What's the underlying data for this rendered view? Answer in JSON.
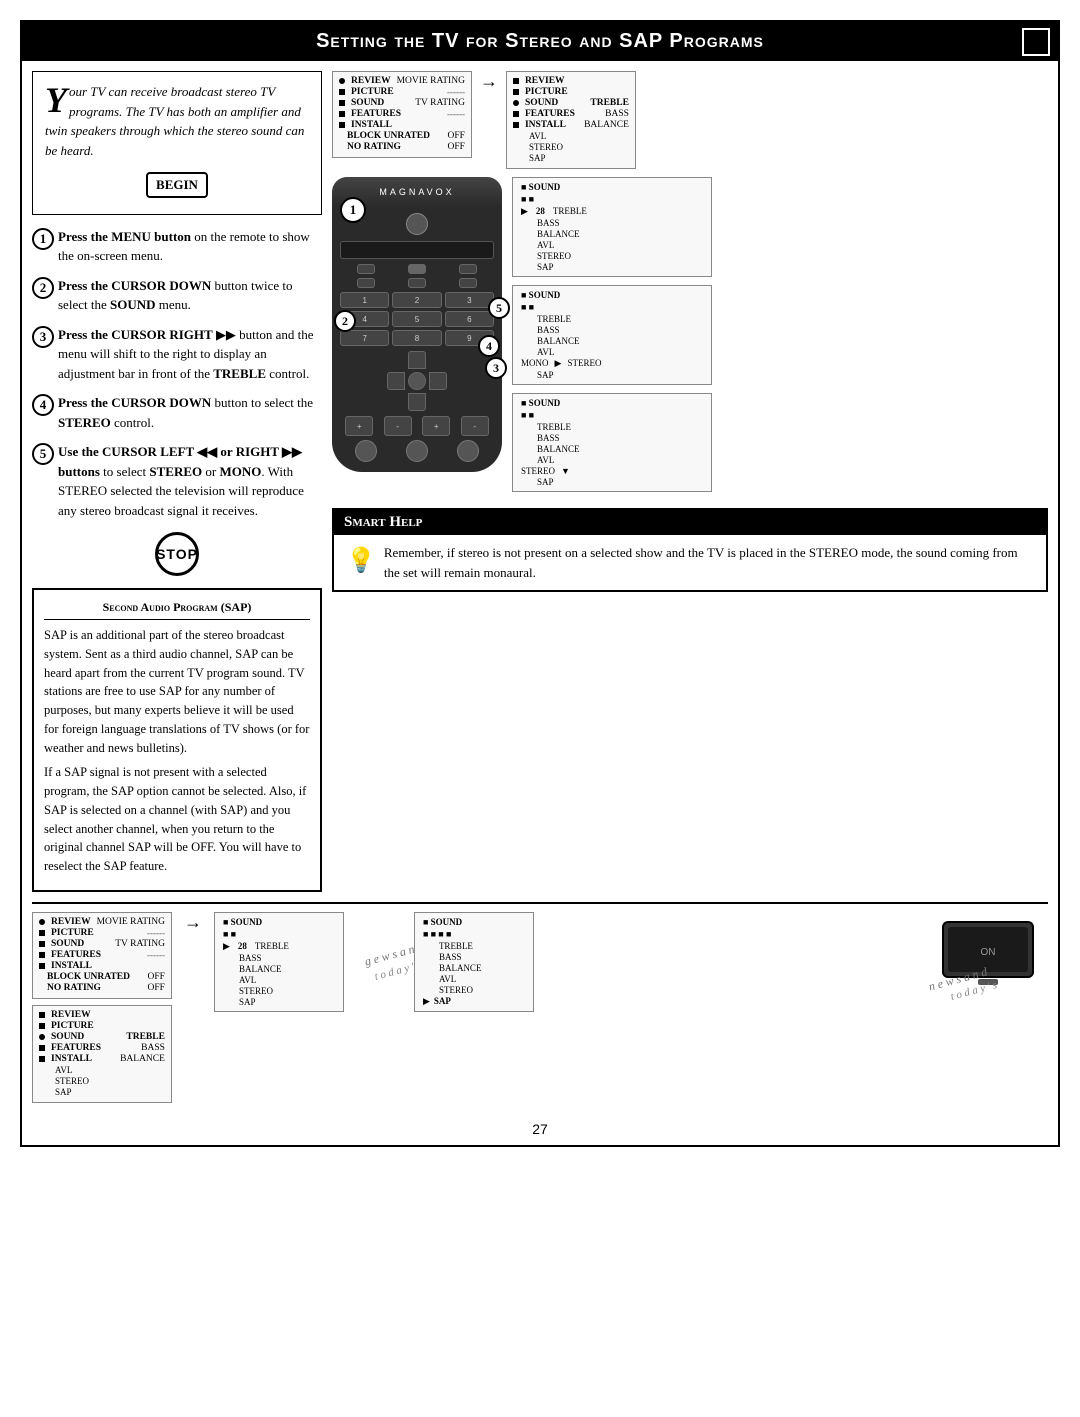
{
  "page": {
    "title": "Setting the TV for Stereo and SAP Programs",
    "page_number": "27"
  },
  "intro": {
    "drop_cap": "Y",
    "text": "our TV can receive broadcast stereo TV programs. The TV has both an amplifier and twin speakers through which the stereo sound can be heard.",
    "begin_label": "BEGIN"
  },
  "steps": [
    {
      "num": "1",
      "bold": "Press the MENU button",
      "text": " on the remote to show the on-screen menu."
    },
    {
      "num": "2",
      "bold": "Press the CURSOR DOWN",
      "text": " button twice to select the SOUND menu."
    },
    {
      "num": "3",
      "bold": "Press the CURSOR RIGHT",
      "text": " button and the menu will shift to the right to display an adjustment bar in front of the TREBLE control."
    },
    {
      "num": "4",
      "bold": "Press the CURSOR DOWN",
      "text": " button to select the STEREO control."
    },
    {
      "num": "5",
      "bold": "Use the CURSOR LEFT or RIGHT buttons",
      "text": " to select STEREO or MONO. With STEREO selected the television will reproduce any stereo broadcast signal it receives."
    }
  ],
  "stop_label": "STOP",
  "smart_help": {
    "title": "Smart Help",
    "text": "Remember, if stereo is not present on a selected show and the TV is placed in the STEREO mode, the sound coming from the set will remain monaural."
  },
  "sap_section": {
    "title": "Second Audio Program (SAP)",
    "paragraphs": [
      "SAP is an additional part of the stereo broadcast system. Sent as a third audio channel, SAP can be heard apart from the current TV program sound. TV stations are free to use SAP for any number of purposes, but many experts believe it will be used for foreign language translations of TV shows (or for weather and news bulletins).",
      "If a SAP signal is not present with a selected program, the SAP option cannot be selected. Also, if SAP is selected on a channel (with SAP) and you select another channel, when you return to the original channel SAP will be OFF. You will have to reselect the SAP feature."
    ]
  },
  "menu_screen_1": {
    "items": [
      {
        "bullet": "dot",
        "label": "REVIEW",
        "value": "MOVIE RATING"
      },
      {
        "bullet": "square",
        "label": "PICTURE",
        "value": "------"
      },
      {
        "bullet": "square",
        "label": "SOUND",
        "value": "TV RATING"
      },
      {
        "bullet": "square",
        "label": "FEATURES",
        "value": "------"
      },
      {
        "bullet": "square",
        "label": "INSTALL",
        "value": ""
      },
      {
        "bullet": "",
        "label": "BLOCK UNRATED",
        "value": "OFF"
      },
      {
        "bullet": "",
        "label": "NO RATING",
        "value": "OFF"
      }
    ]
  },
  "menu_screen_2": {
    "title": "REVIEW",
    "items": [
      {
        "label": "PICTURE",
        "value": ""
      },
      {
        "label": "SOUND",
        "value": "TREBLE"
      },
      {
        "label": "FEATURES",
        "value": "BASS"
      },
      {
        "label": "INSTALL",
        "value": "BALANCE"
      },
      {
        "label": "",
        "value": "AVL"
      },
      {
        "label": "",
        "value": "STEREO"
      },
      {
        "label": "",
        "value": "SAP"
      }
    ]
  },
  "sound_submenu_treble": {
    "title": "SOUND",
    "treble_value": "28",
    "items": [
      "TREBLE",
      "BASS",
      "BALANCE",
      "AVL",
      "STEREO",
      "SAP"
    ]
  },
  "sound_submenu_stereo": {
    "title": "SOUND",
    "mono_label": "MONO",
    "items": [
      "TREBLE",
      "BASS",
      "BALANCE",
      "AVL",
      "STEREO",
      "SAP"
    ]
  },
  "sound_submenu_stereo2": {
    "title": "SOUND",
    "stereo_label": "STEREO",
    "items": [
      "TREBLE",
      "BASS",
      "BALANCE",
      "AVL",
      "STEREO",
      "SAP"
    ]
  },
  "bottom_news_text1": "g e w s   a n d",
  "bottom_news_text2": "t o d a y ' s",
  "bottom_news_text3": "n e w s   a n d",
  "bottom_news_text4": "t o d a y ' s"
}
